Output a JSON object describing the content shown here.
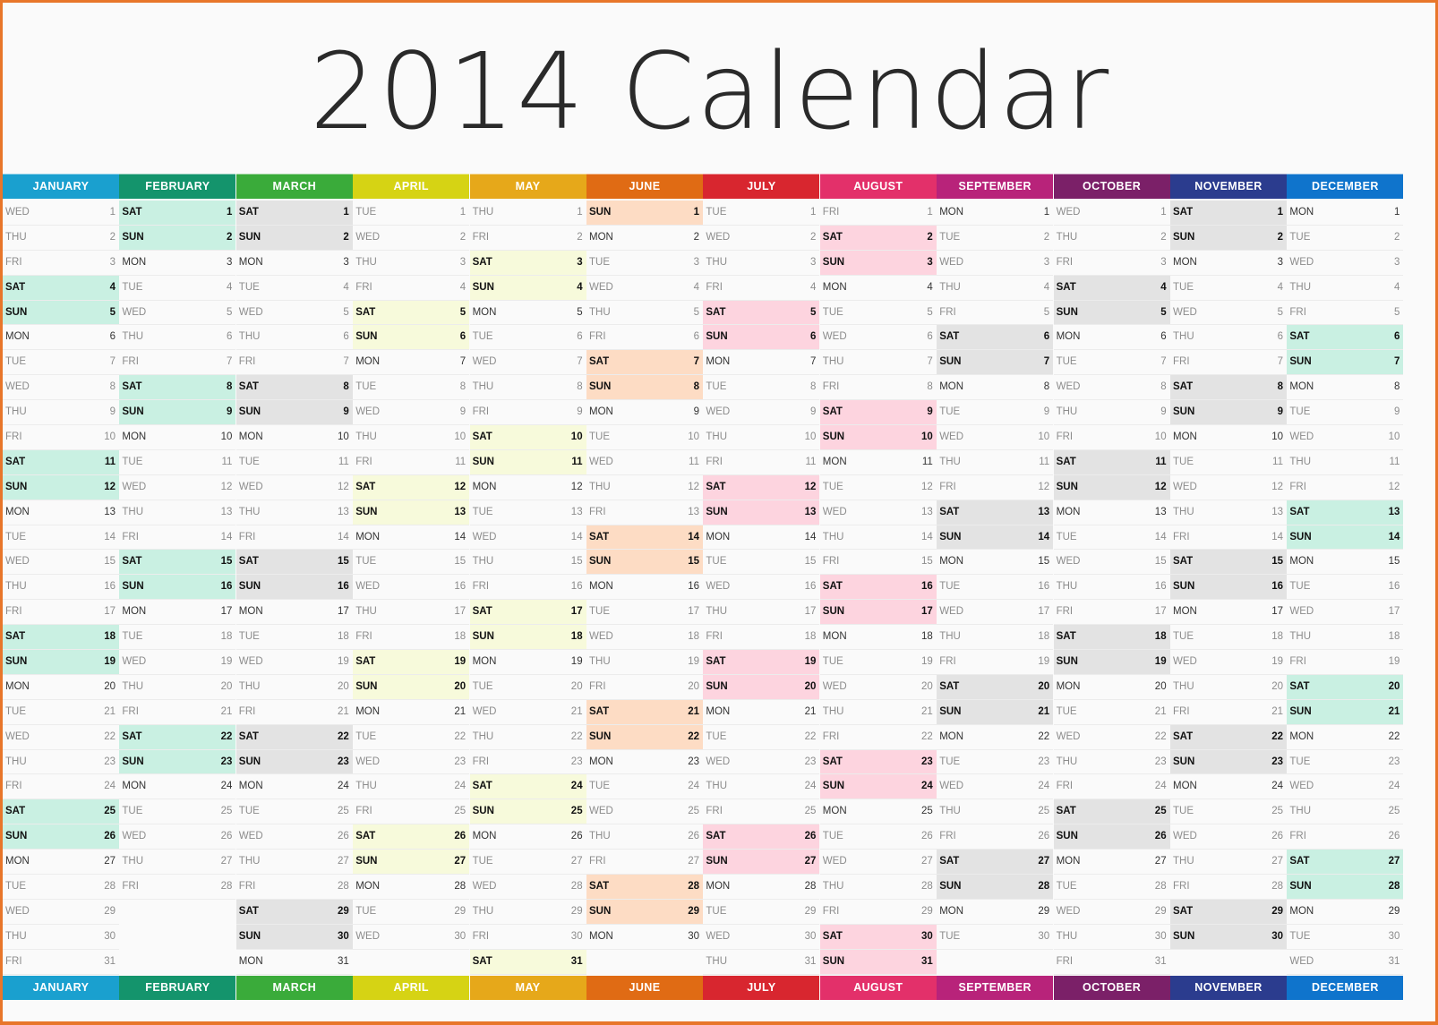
{
  "title": "2014 Calendar",
  "colors": {
    "frame": "#e8762a",
    "weekday_text": "#8c8c8c",
    "weekend_text": "#111111"
  },
  "months": [
    {
      "name": "JANUARY",
      "color": "#1aa0cf",
      "weekend_bg": "#c9f0e2",
      "first_day": "WED",
      "days": 31
    },
    {
      "name": "FEBRUARY",
      "color": "#14946c",
      "weekend_bg": "#c9f0e2",
      "first_day": "SAT",
      "days": 28
    },
    {
      "name": "MARCH",
      "color": "#3aab3a",
      "weekend_bg": "#e3e3e3",
      "first_day": "SAT",
      "days": 31
    },
    {
      "name": "APRIL",
      "color": "#d6d314",
      "weekend_bg": "#f7fadb",
      "first_day": "TUE",
      "days": 30
    },
    {
      "name": "MAY",
      "color": "#e6a81a",
      "weekend_bg": "#f7fadb",
      "first_day": "THU",
      "days": 31
    },
    {
      "name": "JUNE",
      "color": "#e06b14",
      "weekend_bg": "#fddcc4",
      "first_day": "SUN",
      "days": 30
    },
    {
      "name": "JULY",
      "color": "#d8262f",
      "weekend_bg": "#fdd4df",
      "first_day": "TUE",
      "days": 31
    },
    {
      "name": "AUGUST",
      "color": "#e3306a",
      "weekend_bg": "#fdd4df",
      "first_day": "FRI",
      "days": 31
    },
    {
      "name": "SEPTEMBER",
      "color": "#b8237a",
      "weekend_bg": "#e3e3e3",
      "first_day": "MON",
      "days": 30
    },
    {
      "name": "OCTOBER",
      "color": "#7b2068",
      "weekend_bg": "#e3e3e3",
      "first_day": "WED",
      "days": 31
    },
    {
      "name": "NOVEMBER",
      "color": "#2b3c8e",
      "weekend_bg": "#e3e3e3",
      "first_day": "SAT",
      "days": 30
    },
    {
      "name": "DECEMBER",
      "color": "#0f74cc",
      "weekend_bg": "#c9f0e2",
      "first_day": "MON",
      "days": 31
    }
  ],
  "weekdays": [
    "MON",
    "TUE",
    "WED",
    "THU",
    "FRI",
    "SAT",
    "SUN"
  ]
}
